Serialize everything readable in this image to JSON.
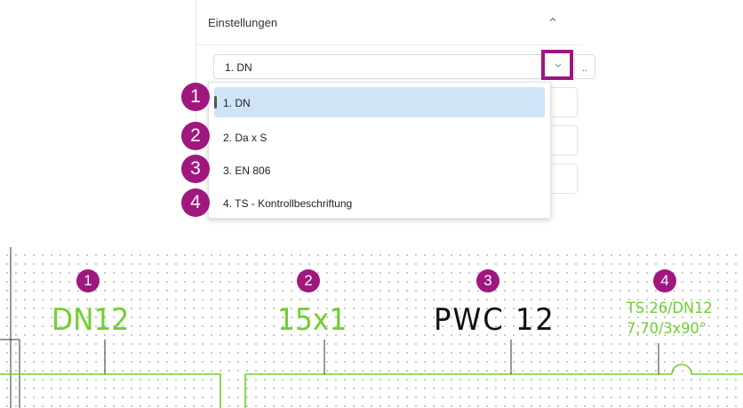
{
  "panel": {
    "title": "Einstellungen",
    "combo_value": "1. DN",
    "ellipsis_label": ".."
  },
  "dropdown": {
    "items": [
      {
        "badge": "1",
        "label": "1. DN",
        "selected": true
      },
      {
        "badge": "2",
        "label": "2. Da x S",
        "selected": false
      },
      {
        "badge": "3",
        "label": "3. EN 806",
        "selected": false
      },
      {
        "badge": "4",
        "label": "4. TS - Kontrollbeschriftung",
        "selected": false
      }
    ]
  },
  "cad": {
    "labels": [
      {
        "badge": "1",
        "text": "DN12",
        "color": "#6fcf2f"
      },
      {
        "badge": "2",
        "text": "15x1",
        "color": "#6fcf2f"
      },
      {
        "badge": "3",
        "text": "PWC 12",
        "color": "#111111"
      },
      {
        "badge": "4",
        "line1": "TS:26/DN12",
        "line2": "7,70/3x90°",
        "color": "#6fcf2f"
      }
    ]
  },
  "colors": {
    "accent": "#a0177e",
    "pipe_green": "#6fcf2f",
    "selection": "#cfe4f7"
  },
  "icons": {
    "collapse": "chevron-up-icon",
    "combo_arrow": "chevron-down-icon"
  }
}
